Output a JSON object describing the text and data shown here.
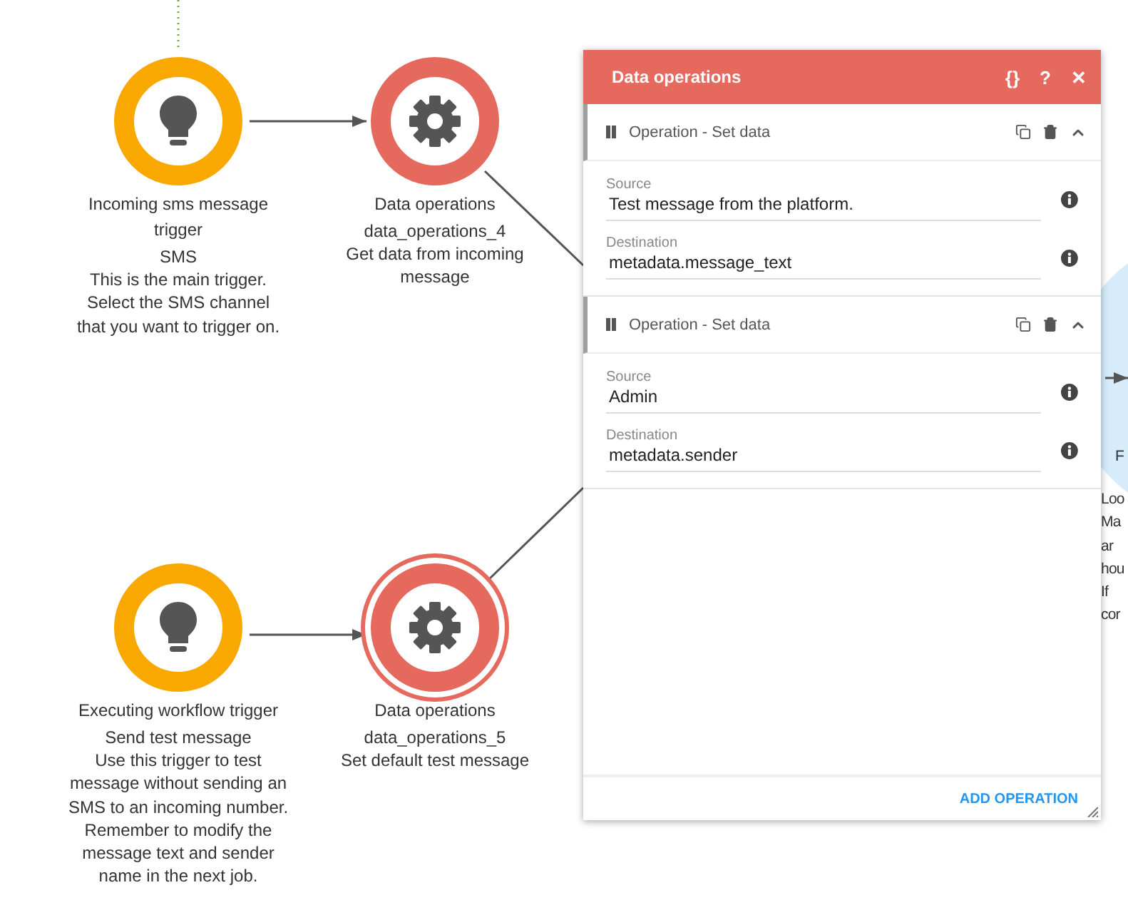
{
  "nodes": [
    {
      "kind": "trigger",
      "title": "Incoming sms message trigger",
      "name": "SMS",
      "description": "This is the main trigger. Select the SMS channel that you want to trigger on.",
      "selected": false
    },
    {
      "kind": "operation",
      "title": "Data operations",
      "name": "data_operations_4",
      "description": "Get data from incoming message",
      "selected": false
    },
    {
      "kind": "trigger",
      "title": "Executing workflow trigger",
      "name": "Send test message",
      "description": "Use this trigger to test message without sending an SMS to an incoming number. Remember to modify the message text and sender name in the next job.",
      "selected": false
    },
    {
      "kind": "operation",
      "title": "Data operations",
      "name": "data_operations_5",
      "description": "Set default test message",
      "selected": true
    }
  ],
  "partial_node": {
    "label": "F",
    "lines": [
      "Loo",
      "Ma",
      "ar",
      "hou",
      "If",
      "cor"
    ]
  },
  "panel": {
    "title": "Data operations",
    "actions": [
      "{}",
      "?",
      "✕"
    ],
    "operations": [
      {
        "title": "Operation - Set data",
        "expanded": true,
        "fields": [
          {
            "label": "Source",
            "value": "Test message from the platform."
          },
          {
            "label": "Destination",
            "value": "metadata.message_text"
          }
        ]
      },
      {
        "title": "Operation - Set data",
        "expanded": true,
        "fields": [
          {
            "label": "Source",
            "value": "Admin"
          },
          {
            "label": "Destination",
            "value": "metadata.sender"
          }
        ]
      }
    ],
    "add_button": "ADD OPERATION"
  }
}
